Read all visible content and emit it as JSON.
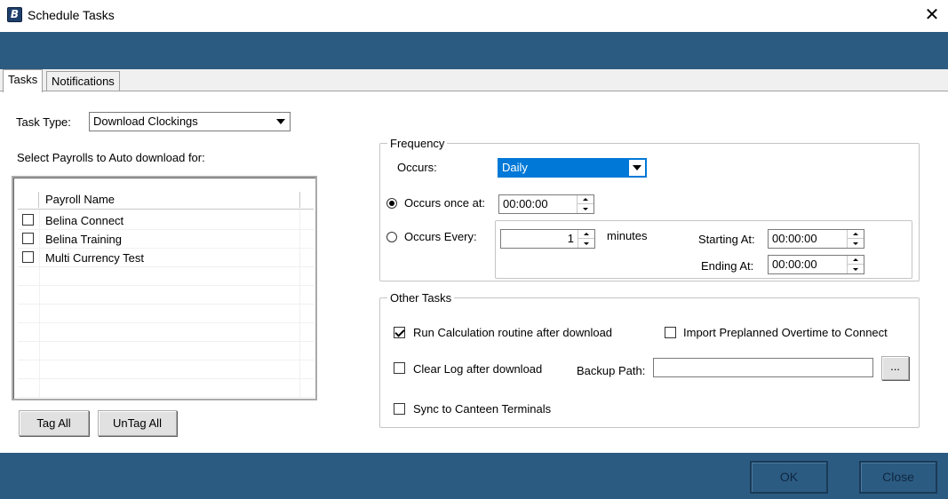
{
  "window": {
    "title": "Schedule Tasks",
    "icon": "app-logo-icon",
    "close_glyph": "✕"
  },
  "tabs": [
    {
      "label": "Tasks",
      "active": true
    },
    {
      "label": "Notifications",
      "active": false
    }
  ],
  "task_type": {
    "label": "Task Type:",
    "value": "Download Clockings"
  },
  "payrolls": {
    "label": "Select Payrolls to Auto download for:",
    "column_header": "Payroll Name",
    "rows": [
      {
        "name": "Belina Connect",
        "checked": false
      },
      {
        "name": "Belina Training",
        "checked": false
      },
      {
        "name": "Multi Currency Test",
        "checked": false
      }
    ],
    "tag_all": "Tag All",
    "untag_all": "UnTag All"
  },
  "frequency": {
    "title": "Frequency",
    "occurs_label": "Occurs:",
    "occurs_value": "Daily",
    "once_label": "Occurs once at:",
    "once_value": "00:00:00",
    "once_selected": true,
    "every_label": "Occurs Every:",
    "every_value": "1",
    "every_unit": "minutes",
    "starting_label": "Starting At:",
    "starting_value": "00:00:00",
    "ending_label": "Ending At:",
    "ending_value": "00:00:00"
  },
  "other_tasks": {
    "title": "Other Tasks",
    "run_calc": {
      "label": "Run Calculation routine after download",
      "checked": true
    },
    "import_overtime": {
      "label": "Import Preplanned Overtime to Connect",
      "checked": false
    },
    "clear_log": {
      "label": "Clear Log after download",
      "checked": false
    },
    "backup_label": "Backup Path:",
    "backup_value": "",
    "browse": "...",
    "sync_canteen": {
      "label": "Sync to Canteen Terminals",
      "checked": false
    }
  },
  "footer": {
    "ok": "OK",
    "close": "Close"
  },
  "colors": {
    "band": "#2c5b82",
    "selection": "#0078d7"
  }
}
